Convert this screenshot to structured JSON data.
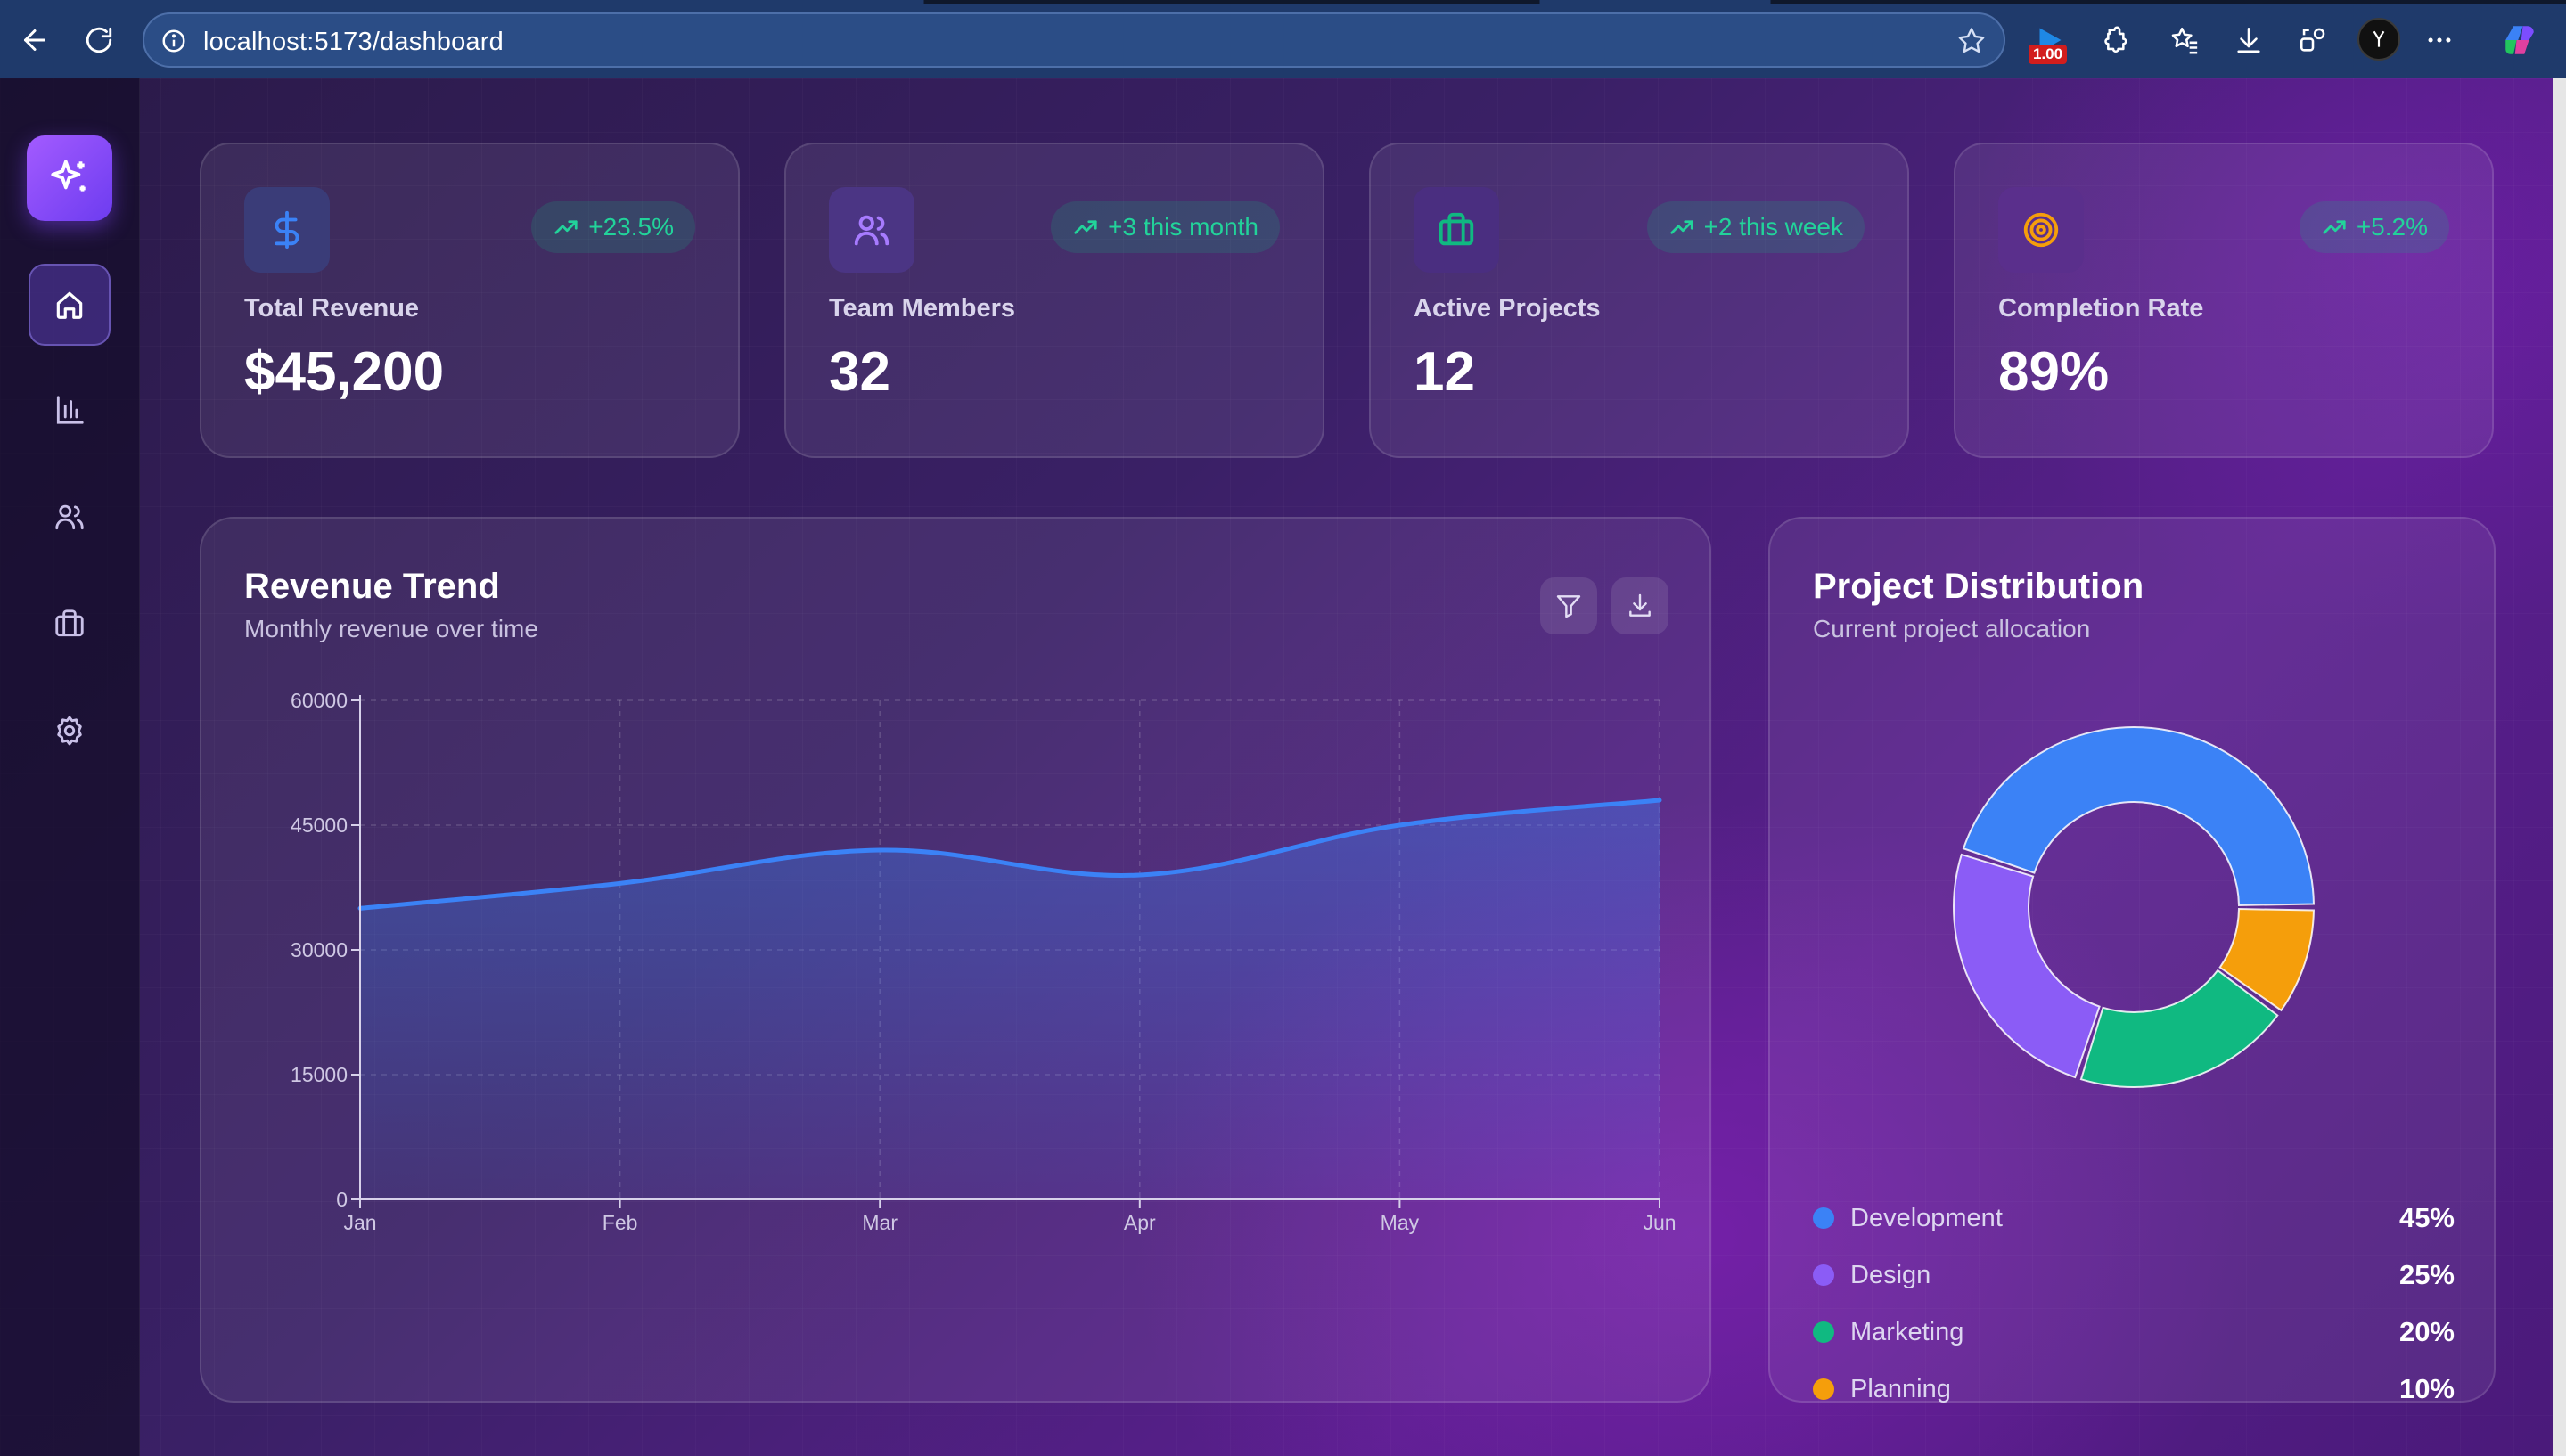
{
  "browser": {
    "url": "localhost:5173/dashboard",
    "speed_badge": "1.00"
  },
  "sidebar": {
    "items": [
      {
        "name": "home",
        "active": true
      },
      {
        "name": "analytics",
        "active": false
      },
      {
        "name": "team",
        "active": false
      },
      {
        "name": "projects",
        "active": false
      },
      {
        "name": "settings",
        "active": false
      }
    ]
  },
  "stats": [
    {
      "label": "Total Revenue",
      "value": "$45,200",
      "change": "+23.5%",
      "icon": "dollar-icon",
      "icon_color": "#3b82f6",
      "icon_bg": "#3a3c78"
    },
    {
      "label": "Team Members",
      "value": "32",
      "change": "+3 this month",
      "icon": "users-icon",
      "icon_color": "#a77bff",
      "icon_bg": "#4b3584"
    },
    {
      "label": "Active Projects",
      "value": "12",
      "change": "+2 this week",
      "icon": "briefcase-icon",
      "icon_color": "#10b981",
      "icon_bg": "#4a2e80"
    },
    {
      "label": "Completion Rate",
      "value": "89%",
      "change": "+5.2%",
      "icon": "target-icon",
      "icon_color": "#f59e0b",
      "icon_bg": "#5a2f8c"
    }
  ],
  "revenue": {
    "title": "Revenue Trend",
    "subtitle": "Monthly revenue over time"
  },
  "distribution": {
    "title": "Project Distribution",
    "subtitle": "Current project allocation"
  },
  "chart_data": [
    {
      "type": "area",
      "title": "Revenue Trend",
      "categories": [
        "Jan",
        "Feb",
        "Mar",
        "Apr",
        "May",
        "Jun"
      ],
      "values": [
        35000,
        38000,
        42000,
        39000,
        45000,
        48000
      ],
      "yticks": [
        0,
        15000,
        30000,
        45000,
        60000
      ],
      "ylim": [
        0,
        60000
      ],
      "grid": true,
      "line_color": "#3b82f6"
    },
    {
      "type": "pie",
      "title": "Project Distribution",
      "categories": [
        "Development",
        "Design",
        "Marketing",
        "Planning"
      ],
      "values": [
        45,
        25,
        20,
        10
      ],
      "labels": [
        "45%",
        "25%",
        "20%",
        "10%"
      ],
      "colors": [
        "#3b82f6",
        "#8b5cf6",
        "#10b981",
        "#f59e0b"
      ],
      "donut": true
    }
  ]
}
